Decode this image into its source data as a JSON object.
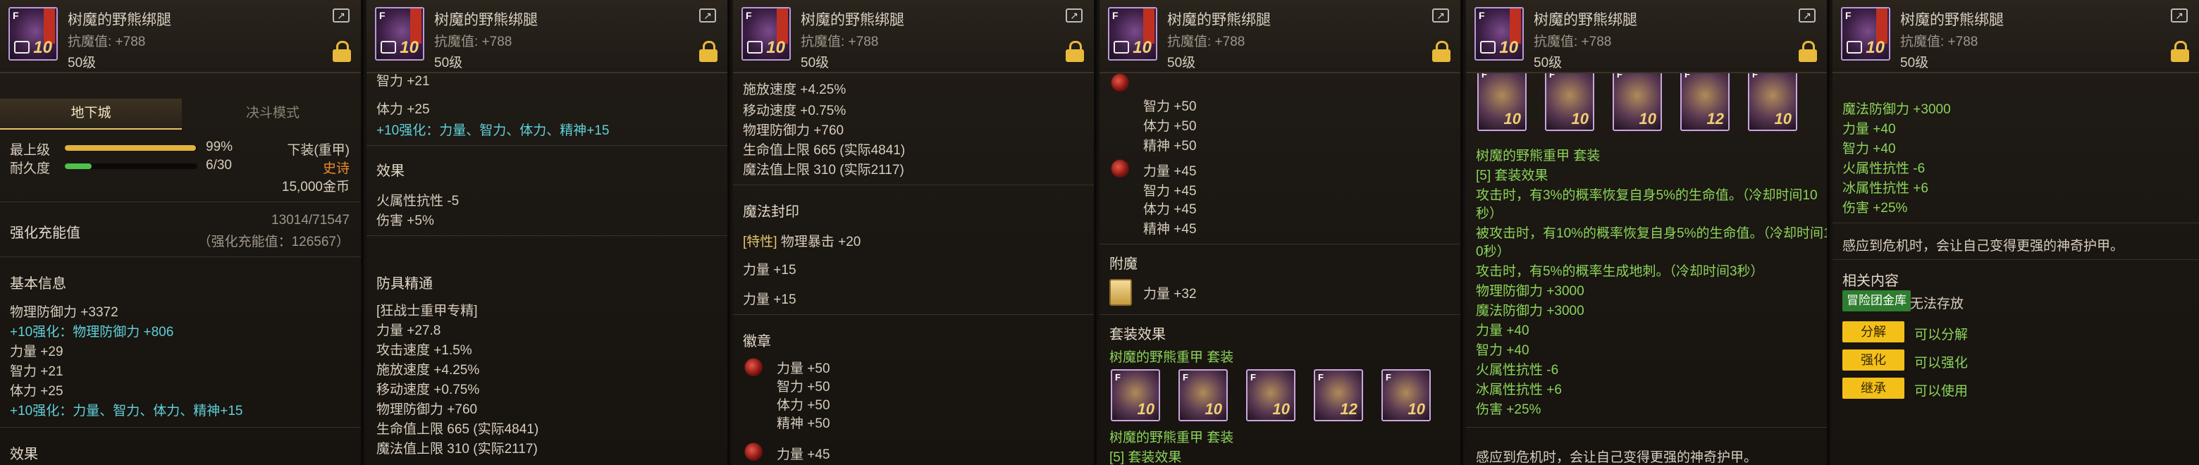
{
  "item": {
    "name": "树魔的野熊绑腿",
    "magic_resist": "抗魔值: +788",
    "level": "50级",
    "icon_level": "10",
    "icon_grade": "F",
    "icon": "bear-leg-armor-icon"
  },
  "p1": {
    "tabs": [
      "地下城",
      "决斗模式"
    ],
    "rows": [
      {
        "label": "最上级",
        "value": "99%",
        "bar": 0.99,
        "color": "#e3b23c"
      },
      {
        "label": "耐久度",
        "value": "6/30",
        "bar": 0.2,
        "color": "#4fc04a"
      }
    ],
    "slot": "下装(重甲)",
    "rarity": "史诗",
    "price": "15,000金币",
    "reinforce_title": "强化充能值",
    "reinforce_value": "13014/71547",
    "reinforce_sub": "（强化充能值：126567）",
    "basic_title": "基本信息",
    "lines": [
      {
        "t": "物理防御力 +3372",
        "c": ""
      },
      {
        "t": "+10强化：物理防御力 +806",
        "c": "cy"
      },
      {
        "t": "力量 +29",
        "c": ""
      },
      {
        "t": "智力 +21",
        "c": ""
      },
      {
        "t": "体力 +25",
        "c": ""
      },
      {
        "t": "+10强化：力量、智力、体力、精神+15",
        "c": "cy"
      }
    ],
    "effect_title": "效果"
  },
  "p2": {
    "lines_top": [
      {
        "t": "智力 +21",
        "c": ""
      },
      {
        "t": "体力 +25",
        "c": ""
      },
      {
        "t": "+10强化：力量、智力、体力、精神+15",
        "c": "cy"
      }
    ],
    "effect_title": "效果",
    "effect_lines": [
      "火属性抗性 -5",
      "伤害 +5%"
    ],
    "mastery_title": "防具精通",
    "mastery_lines": [
      "[狂战士重甲专精]",
      "力量 +27.8",
      "攻击速度 +1.5%",
      "施放速度 +4.25%",
      "移动速度 +0.75%",
      "物理防御力 +760",
      "生命值上限 665 (实际4841)",
      "魔法值上限 310 (实际2117)"
    ]
  },
  "p3": {
    "lines_top": [
      "施放速度 +4.25%",
      "移动速度 +0.75%",
      "物理防御力 +760",
      "生命值上限 665 (实际4841)",
      "魔法值上限 310 (实际2117)"
    ],
    "seal_title": "魔法封印",
    "seal_line_tag": "[特性]",
    "seal_line": "物理暴击 +20",
    "seal_lines": [
      "力量 +15",
      "力量 +15"
    ],
    "emblem_title": "徽章",
    "emblem_lines": [
      "力量 +50",
      "智力 +50",
      "体力 +50",
      "精神 +50"
    ],
    "emblem2_line": "力量 +45"
  },
  "p4": {
    "emblem_lines_a": [
      "智力 +50",
      "体力 +50",
      "精神 +50"
    ],
    "emblem_lines_b": [
      "力量 +45",
      "智力 +45",
      "体力 +45",
      "精神 +45"
    ],
    "enchant_title": "附魔",
    "enchant_line": "力量 +32",
    "set_title": "套装效果",
    "set_name": "树魔的野熊重甲  套装",
    "set_levels": [
      "10",
      "10",
      "10",
      "12",
      "10"
    ],
    "set_name2": "树魔的野熊重甲  套装",
    "set_count": "[5] 套装效果"
  },
  "p5": {
    "set_levels": [
      "10",
      "10",
      "10",
      "12",
      "10"
    ],
    "set_name": "树魔的野熊重甲  套装",
    "set_count": "[5] 套装效果",
    "lines": [
      "攻击时，有3%的概率恢复自身5%的生命值。（冷却时间10",
      "秒）",
      "被攻击时，有10%的概率恢复自身5%的生命值。（冷却时间1",
      "0秒）",
      "攻击时，有5%的概率生成地刺。（冷却时间3秒）",
      "物理防御力 +3000",
      "魔法防御力 +3000",
      "力量 +40",
      "智力 +40",
      "火属性抗性 -6",
      "冰属性抗性 +6",
      "伤害 +25%"
    ],
    "footer": "感应到危机时，会让自己变得更强的神奇护甲。"
  },
  "p6": {
    "lines": [
      "魔法防御力 +3000",
      "力量 +40",
      "智力 +40",
      "火属性抗性 -6",
      "冰属性抗性 +6",
      "伤害 +25%"
    ],
    "footer": "感应到危机时，会让自己变得更强的神奇护甲。",
    "related_title": "相关内容",
    "related": [
      {
        "tag": "冒险团金库",
        "value": "无法存放"
      },
      {
        "tag": "分解",
        "value": "可以分解"
      },
      {
        "tag": "强化",
        "value": "可以强化"
      },
      {
        "tag": "继承",
        "value": "可以使用"
      }
    ]
  }
}
